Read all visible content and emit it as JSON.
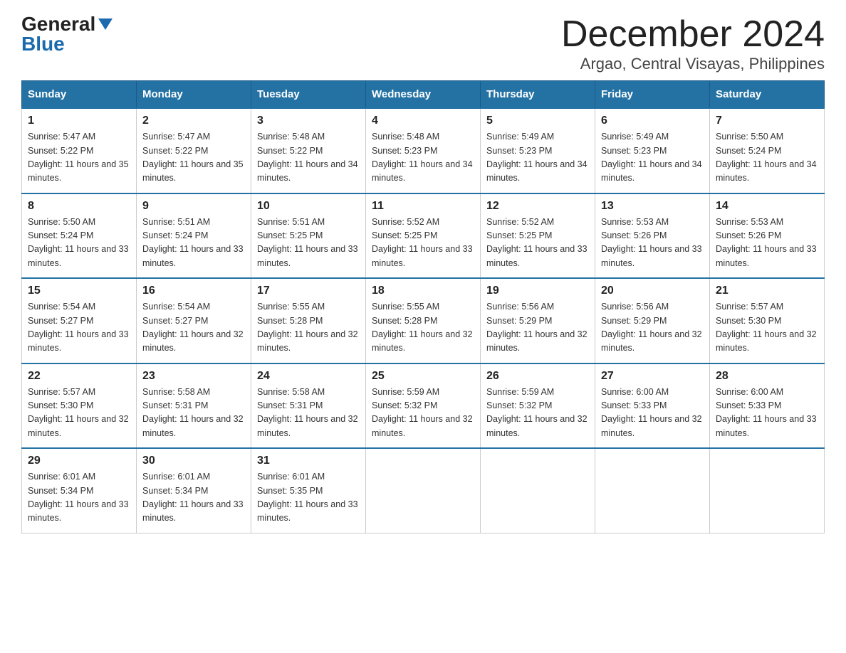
{
  "logo": {
    "general": "General",
    "blue": "Blue"
  },
  "title": "December 2024",
  "subtitle": "Argao, Central Visayas, Philippines",
  "weekdays": [
    "Sunday",
    "Monday",
    "Tuesday",
    "Wednesday",
    "Thursday",
    "Friday",
    "Saturday"
  ],
  "weeks": [
    [
      {
        "day": "1",
        "sunrise": "5:47 AM",
        "sunset": "5:22 PM",
        "daylight": "11 hours and 35 minutes."
      },
      {
        "day": "2",
        "sunrise": "5:47 AM",
        "sunset": "5:22 PM",
        "daylight": "11 hours and 35 minutes."
      },
      {
        "day": "3",
        "sunrise": "5:48 AM",
        "sunset": "5:22 PM",
        "daylight": "11 hours and 34 minutes."
      },
      {
        "day": "4",
        "sunrise": "5:48 AM",
        "sunset": "5:23 PM",
        "daylight": "11 hours and 34 minutes."
      },
      {
        "day": "5",
        "sunrise": "5:49 AM",
        "sunset": "5:23 PM",
        "daylight": "11 hours and 34 minutes."
      },
      {
        "day": "6",
        "sunrise": "5:49 AM",
        "sunset": "5:23 PM",
        "daylight": "11 hours and 34 minutes."
      },
      {
        "day": "7",
        "sunrise": "5:50 AM",
        "sunset": "5:24 PM",
        "daylight": "11 hours and 34 minutes."
      }
    ],
    [
      {
        "day": "8",
        "sunrise": "5:50 AM",
        "sunset": "5:24 PM",
        "daylight": "11 hours and 33 minutes."
      },
      {
        "day": "9",
        "sunrise": "5:51 AM",
        "sunset": "5:24 PM",
        "daylight": "11 hours and 33 minutes."
      },
      {
        "day": "10",
        "sunrise": "5:51 AM",
        "sunset": "5:25 PM",
        "daylight": "11 hours and 33 minutes."
      },
      {
        "day": "11",
        "sunrise": "5:52 AM",
        "sunset": "5:25 PM",
        "daylight": "11 hours and 33 minutes."
      },
      {
        "day": "12",
        "sunrise": "5:52 AM",
        "sunset": "5:25 PM",
        "daylight": "11 hours and 33 minutes."
      },
      {
        "day": "13",
        "sunrise": "5:53 AM",
        "sunset": "5:26 PM",
        "daylight": "11 hours and 33 minutes."
      },
      {
        "day": "14",
        "sunrise": "5:53 AM",
        "sunset": "5:26 PM",
        "daylight": "11 hours and 33 minutes."
      }
    ],
    [
      {
        "day": "15",
        "sunrise": "5:54 AM",
        "sunset": "5:27 PM",
        "daylight": "11 hours and 33 minutes."
      },
      {
        "day": "16",
        "sunrise": "5:54 AM",
        "sunset": "5:27 PM",
        "daylight": "11 hours and 32 minutes."
      },
      {
        "day": "17",
        "sunrise": "5:55 AM",
        "sunset": "5:28 PM",
        "daylight": "11 hours and 32 minutes."
      },
      {
        "day": "18",
        "sunrise": "5:55 AM",
        "sunset": "5:28 PM",
        "daylight": "11 hours and 32 minutes."
      },
      {
        "day": "19",
        "sunrise": "5:56 AM",
        "sunset": "5:29 PM",
        "daylight": "11 hours and 32 minutes."
      },
      {
        "day": "20",
        "sunrise": "5:56 AM",
        "sunset": "5:29 PM",
        "daylight": "11 hours and 32 minutes."
      },
      {
        "day": "21",
        "sunrise": "5:57 AM",
        "sunset": "5:30 PM",
        "daylight": "11 hours and 32 minutes."
      }
    ],
    [
      {
        "day": "22",
        "sunrise": "5:57 AM",
        "sunset": "5:30 PM",
        "daylight": "11 hours and 32 minutes."
      },
      {
        "day": "23",
        "sunrise": "5:58 AM",
        "sunset": "5:31 PM",
        "daylight": "11 hours and 32 minutes."
      },
      {
        "day": "24",
        "sunrise": "5:58 AM",
        "sunset": "5:31 PM",
        "daylight": "11 hours and 32 minutes."
      },
      {
        "day": "25",
        "sunrise": "5:59 AM",
        "sunset": "5:32 PM",
        "daylight": "11 hours and 32 minutes."
      },
      {
        "day": "26",
        "sunrise": "5:59 AM",
        "sunset": "5:32 PM",
        "daylight": "11 hours and 32 minutes."
      },
      {
        "day": "27",
        "sunrise": "6:00 AM",
        "sunset": "5:33 PM",
        "daylight": "11 hours and 32 minutes."
      },
      {
        "day": "28",
        "sunrise": "6:00 AM",
        "sunset": "5:33 PM",
        "daylight": "11 hours and 33 minutes."
      }
    ],
    [
      {
        "day": "29",
        "sunrise": "6:01 AM",
        "sunset": "5:34 PM",
        "daylight": "11 hours and 33 minutes."
      },
      {
        "day": "30",
        "sunrise": "6:01 AM",
        "sunset": "5:34 PM",
        "daylight": "11 hours and 33 minutes."
      },
      {
        "day": "31",
        "sunrise": "6:01 AM",
        "sunset": "5:35 PM",
        "daylight": "11 hours and 33 minutes."
      },
      null,
      null,
      null,
      null
    ]
  ],
  "labels": {
    "sunrise": "Sunrise: ",
    "sunset": "Sunset: ",
    "daylight": "Daylight: "
  }
}
